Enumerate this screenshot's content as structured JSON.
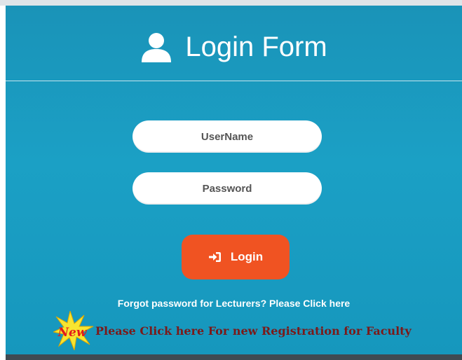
{
  "header": {
    "title": "Login Form",
    "icon": "user-icon"
  },
  "form": {
    "username_placeholder": "UserName",
    "password_placeholder": "Password",
    "login_label": "Login",
    "login_icon": "sign-in-icon"
  },
  "links": {
    "forgot_password": "Forgot password for Lecturers? Please Click here",
    "new_badge": "New",
    "registration": "Please Click here For new Registration for Faculty"
  },
  "colors": {
    "panel": "#1a9ac0",
    "login_button": "#f05322",
    "registration_link": "#7a1a1a",
    "badge_star": "#f7e531",
    "badge_text": "#e31b1b"
  }
}
